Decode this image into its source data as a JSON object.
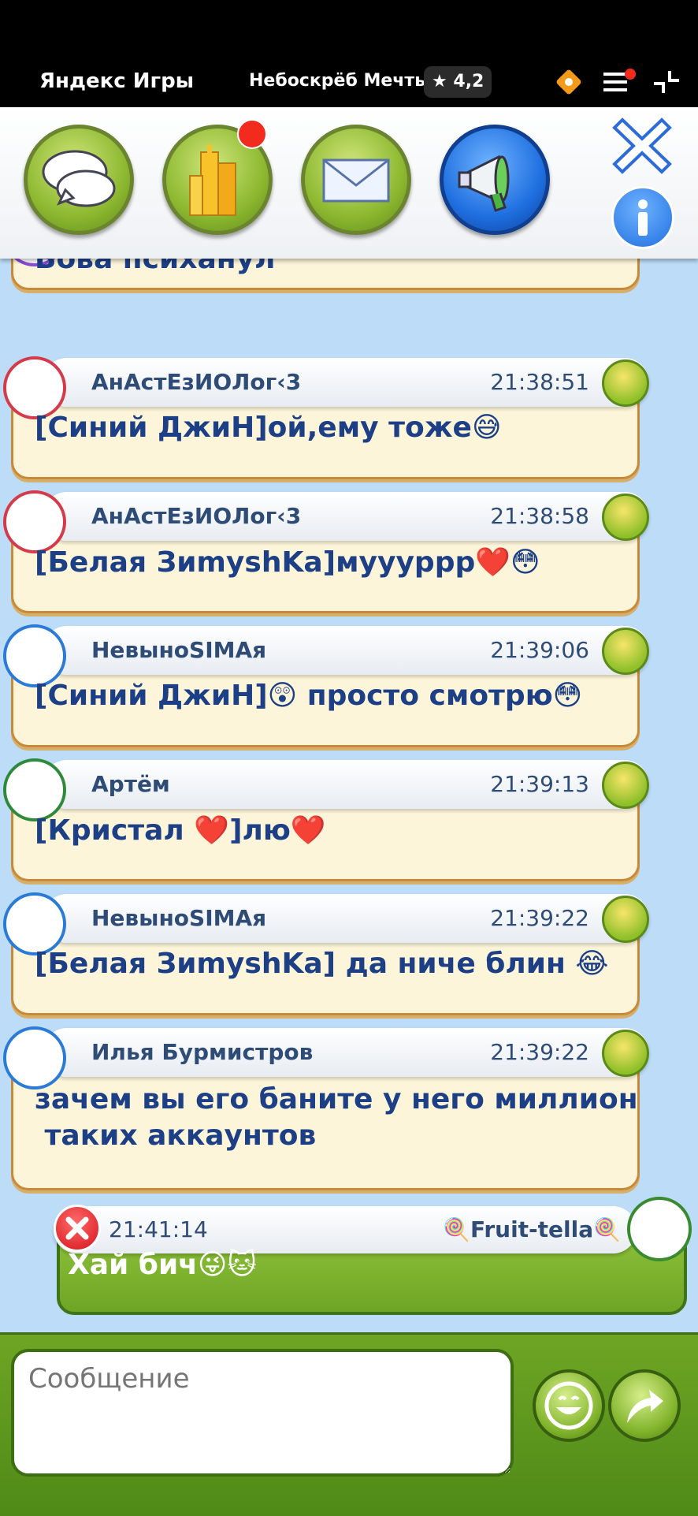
{
  "yandex_bar": {
    "brand": "Яндекс Игры",
    "game_title": "Небоскрёб Мечты",
    "rating": "★ 4,2",
    "icons": [
      "promo-icon",
      "menu-icon",
      "collapse-icon"
    ]
  },
  "toolbar": {
    "buttons": [
      "chat-icon",
      "skyscraper-icon",
      "mail-icon",
      "megaphone-icon"
    ],
    "actions": [
      "close-icon",
      "info-icon"
    ]
  },
  "chat": {
    "partial_message": {
      "text": "Вова психанул"
    },
    "messages": [
      {
        "nick": "АнАстЕзИОЛог‹3",
        "time": "21:38:51",
        "text": "[Синий ДжиН]ой,ему тоже😅"
      },
      {
        "nick": "АнАстЕзИОЛог‹3",
        "time": "21:38:58",
        "text": "[Белая ЗиmyshKa]муууррр❤️😳"
      },
      {
        "nick": "НевыноSIMAя",
        "time": "21:39:06",
        "text": "[Синий ДжиН]😲 просто смотрю😳"
      },
      {
        "nick": "Артём",
        "time": "21:39:13",
        "text": "[Кристал ❤️]лю❤️"
      },
      {
        "nick": "НевыноSIMAя",
        "time": "21:39:22",
        "text": "[Белая ЗиmyshKa] да ниче блин 😂"
      },
      {
        "nick": "Илья Бурмистров",
        "time": "21:39:22",
        "text": "зачем вы его баните у него миллион\n таких аккаунтов"
      }
    ],
    "own_message": {
      "time": "21:41:14",
      "nick": "🍭Fruit-tella🍭",
      "text": "Хай бич😜🐱"
    }
  },
  "input": {
    "placeholder": "Сообщение"
  },
  "colors": {
    "accent_green": "#7fb22a",
    "text_blue": "#1c3f86",
    "bubble": "#fdf5d9",
    "bubble_border": "#c88a3a"
  }
}
